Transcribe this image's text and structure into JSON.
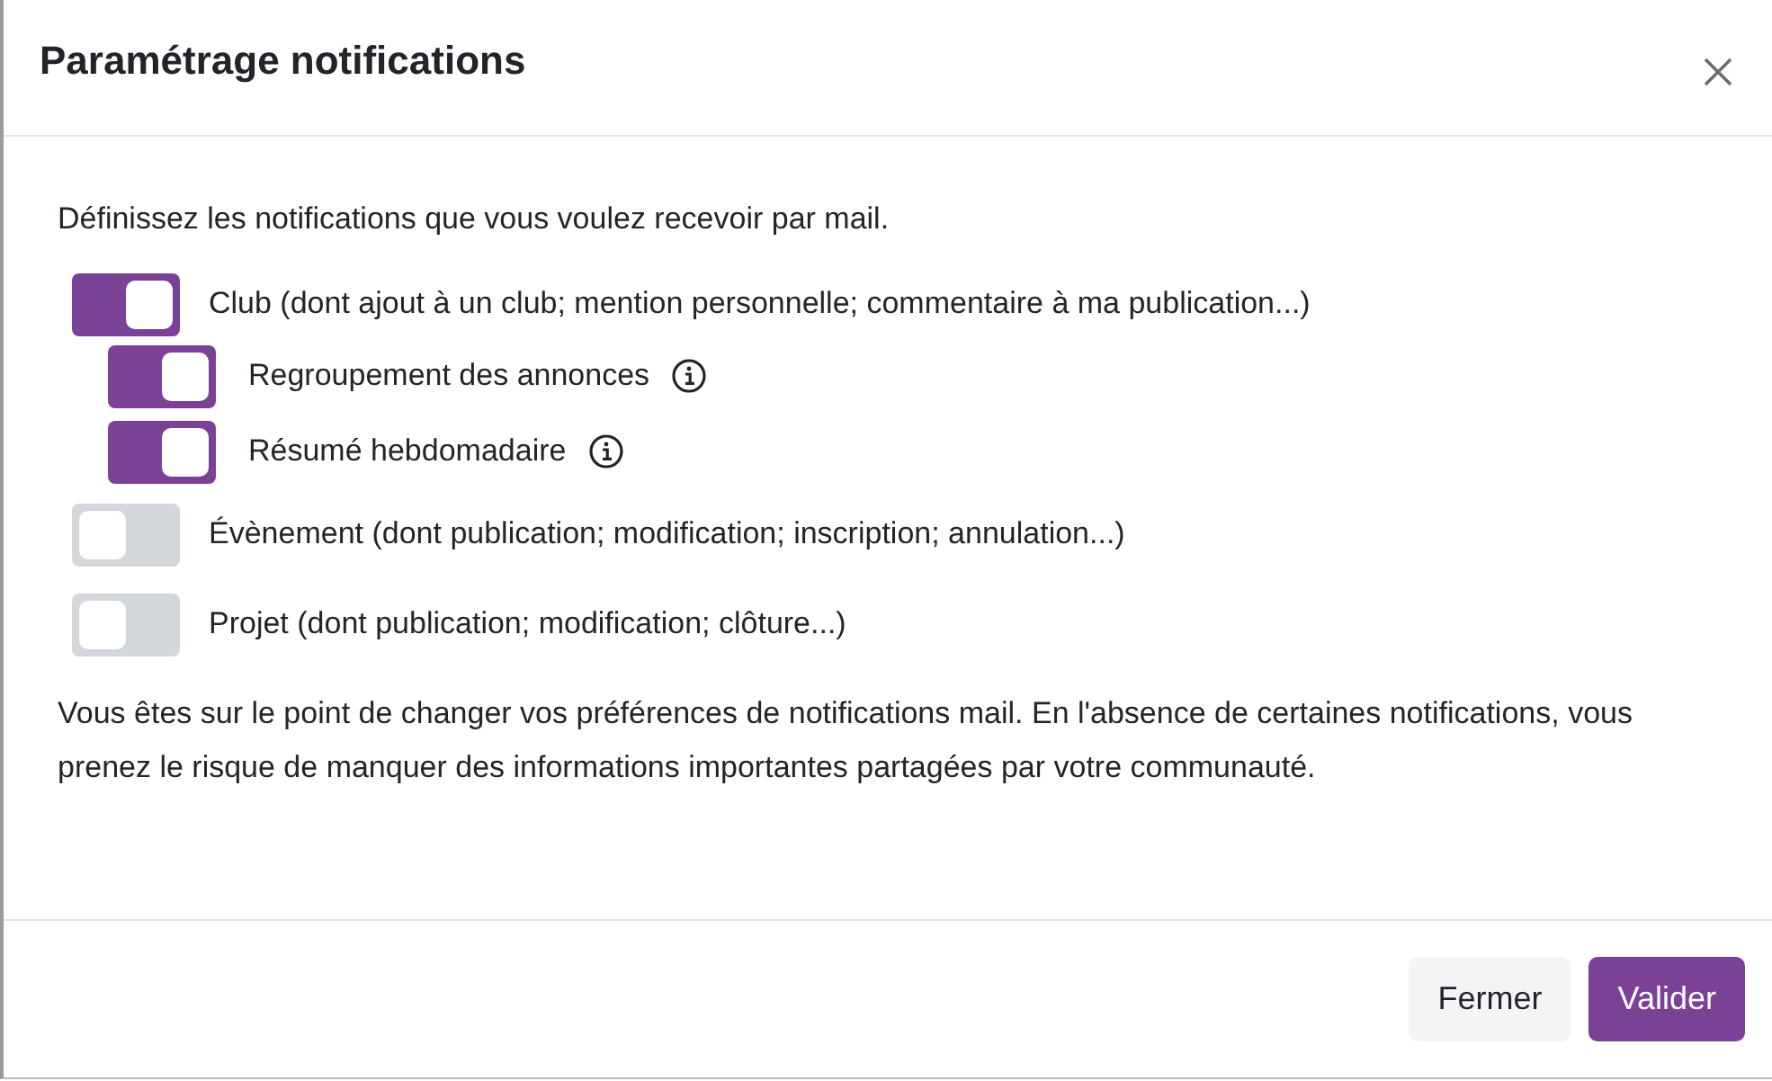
{
  "dialog": {
    "title": "Paramétrage notifications",
    "intro": "Définissez les notifications que vous voulez recevoir par mail.",
    "settings": [
      {
        "label": "Club (dont ajout à un club; mention personnelle; commentaire à ma publication...)",
        "on": true,
        "info": false,
        "children": [
          {
            "label": "Regroupement des annonces",
            "on": true,
            "info": true
          },
          {
            "label": "Résumé hebdomadaire",
            "on": true,
            "info": true
          }
        ]
      },
      {
        "label": "Évènement (dont publication; modification; inscription; annulation...)",
        "on": false,
        "info": false
      },
      {
        "label": "Projet (dont publication; modification; clôture...)",
        "on": false,
        "info": false
      }
    ],
    "warning": "Vous êtes sur le point de changer vos préférences de notifications mail. En l'absence de certaines notifications, vous prenez le risque de manquer des informations importantes partagées par votre communauté.",
    "buttons": [
      {
        "label": "Fermer",
        "kind": "secondary"
      },
      {
        "label": "Valider",
        "kind": "primary"
      }
    ]
  }
}
